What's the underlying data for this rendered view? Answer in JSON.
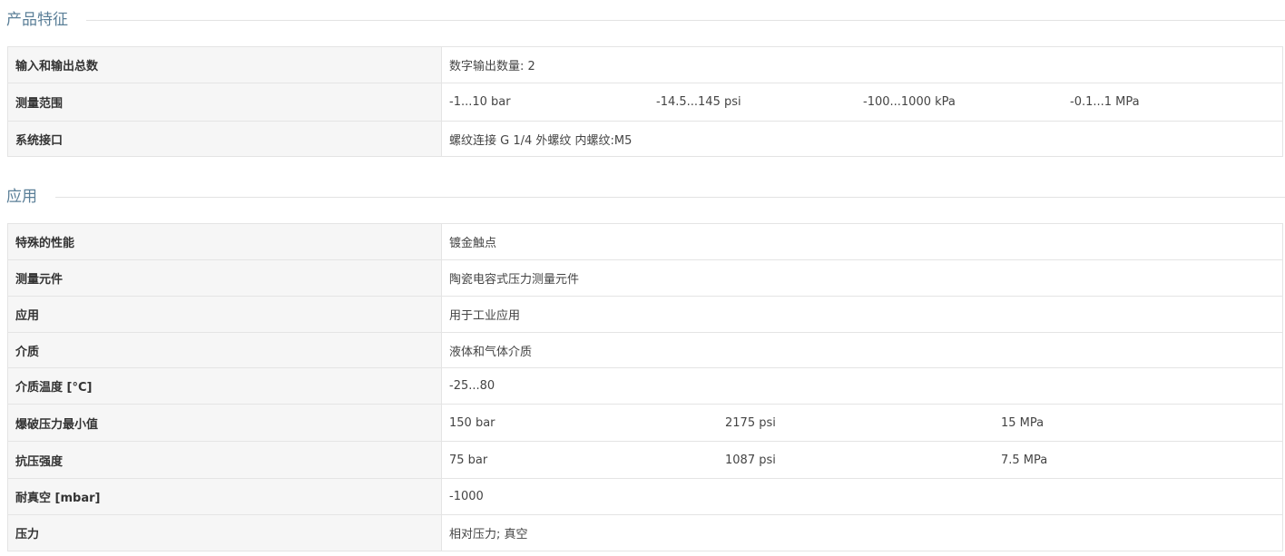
{
  "sections": [
    {
      "title": "产品特征",
      "rows": [
        {
          "label": "输入和输出总数",
          "values": [
            "数字输出数量: 2"
          ]
        },
        {
          "label": "测量范围",
          "values": [
            "-1...10 bar",
            "-14.5...145 psi",
            "-100...1000 kPa",
            "-0.1...1 MPa"
          ]
        },
        {
          "label": "系统接口",
          "values": [
            "螺纹连接 G 1/4 外螺纹 内螺纹:M5"
          ]
        }
      ]
    },
    {
      "title": "应用",
      "rows": [
        {
          "label": "特殊的性能",
          "values": [
            "镀金触点"
          ]
        },
        {
          "label": "测量元件",
          "values": [
            "陶瓷电容式压力测量元件"
          ]
        },
        {
          "label": "应用",
          "values": [
            "用于工业应用"
          ]
        },
        {
          "label": "介质",
          "values": [
            "液体和气体介质"
          ]
        },
        {
          "label": "介质温度 [°C]",
          "values": [
            "-25...80"
          ]
        },
        {
          "label": "爆破压力最小值",
          "values": [
            "150 bar",
            "2175 psi",
            "15 MPa"
          ]
        },
        {
          "label": "抗压强度",
          "values": [
            "75 bar",
            "1087 psi",
            "7.5 MPa"
          ]
        },
        {
          "label": "耐真空 [mbar]",
          "values": [
            "-1000"
          ]
        },
        {
          "label": "压力",
          "values": [
            "相对压力; 真空"
          ]
        }
      ]
    }
  ]
}
